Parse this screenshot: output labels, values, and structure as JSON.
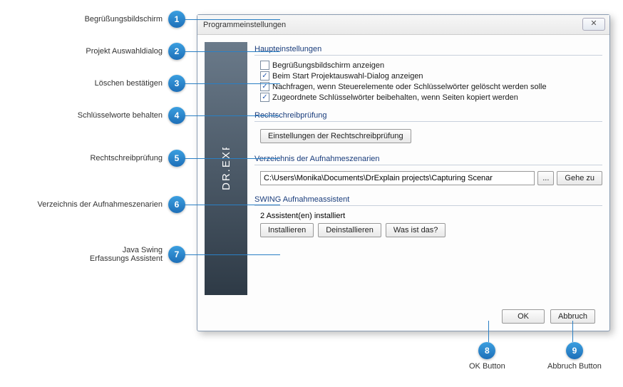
{
  "dialog": {
    "title": "Programmeinstellungen",
    "close_glyph": "✕"
  },
  "banner": {
    "text": "DR.EXPLAIN"
  },
  "sections": {
    "main": {
      "header": "Haupteinstellungen",
      "chk_welcome": {
        "label": "Begrüßungsbildschirm anzeigen",
        "checked": false
      },
      "chk_proj": {
        "label": "Beim Start Projektauswahl-Dialog anzeigen",
        "checked": true
      },
      "chk_delete": {
        "label": "Nachfragen, wenn Steuerelemente oder Schlüsselwörter gelöscht werden solle",
        "checked": true
      },
      "chk_keep": {
        "label": "Zugeordnete Schlüsselwörter beibehalten, wenn Seiten kopiert werden",
        "checked": true
      }
    },
    "spell": {
      "header": "Rechtschreibprüfung",
      "button": "Einstellungen der Rechtschreibprüfung"
    },
    "capture_dir": {
      "header": "Verzeichnis der Aufnahmeszenarien",
      "path": "C:\\Users\\Monika\\Documents\\DrExplain projects\\Capturing Scenar",
      "browse": "...",
      "goto": "Gehe zu"
    },
    "swing": {
      "header": "SWING Aufnahmeassistent",
      "status": "2 Assistent(en) installiert",
      "install": "Installieren",
      "uninstall": "Deinstallieren",
      "whatis": "Was ist das?"
    }
  },
  "footer": {
    "ok": "OK",
    "cancel": "Abbruch"
  },
  "callouts": {
    "1": "Begrüßungsbildschirm",
    "2": "Projekt Auswahldialog",
    "3": "Löschen bestätigen",
    "4": "Schlüsselworte behalten",
    "5": "Rechtschreibprüfung",
    "6": "Verzeichnis der Aufnahmeszenarien",
    "7": "Java Swing\nErfassungs Assistent",
    "8": "OK Button",
    "9": "Abbruch Button"
  }
}
